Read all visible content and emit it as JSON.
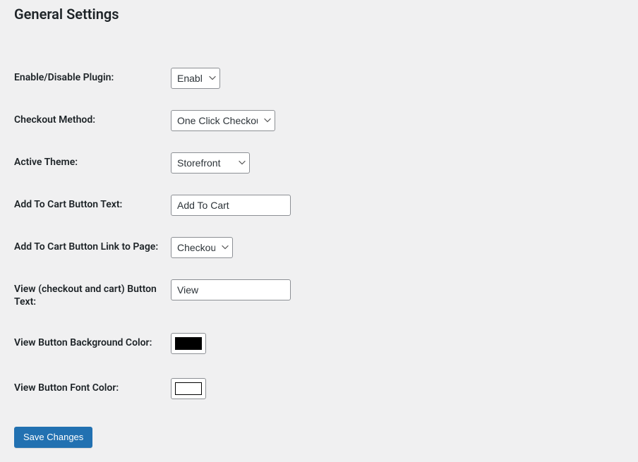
{
  "page": {
    "title": "General Settings"
  },
  "fields": {
    "enablePlugin": {
      "label": "Enable/Disable Plugin:",
      "value": "Enable"
    },
    "checkoutMethod": {
      "label": "Checkout Method:",
      "value": "One Click Checkout"
    },
    "activeTheme": {
      "label": "Active Theme:",
      "value": "Storefront"
    },
    "addToCartText": {
      "label": "Add To Cart Button Text:",
      "value": "Add To Cart"
    },
    "addToCartLink": {
      "label": "Add To Cart Button Link to Page:",
      "value": "Checkout"
    },
    "viewButtonText": {
      "label": "View (checkout and cart) Button Text:",
      "value": "View"
    },
    "viewBgColor": {
      "label": "View Button Background Color:",
      "value": "#000000"
    },
    "viewFontColor": {
      "label": "View Button Font Color:",
      "value": "#ffffff"
    }
  },
  "actions": {
    "save": "Save Changes"
  }
}
